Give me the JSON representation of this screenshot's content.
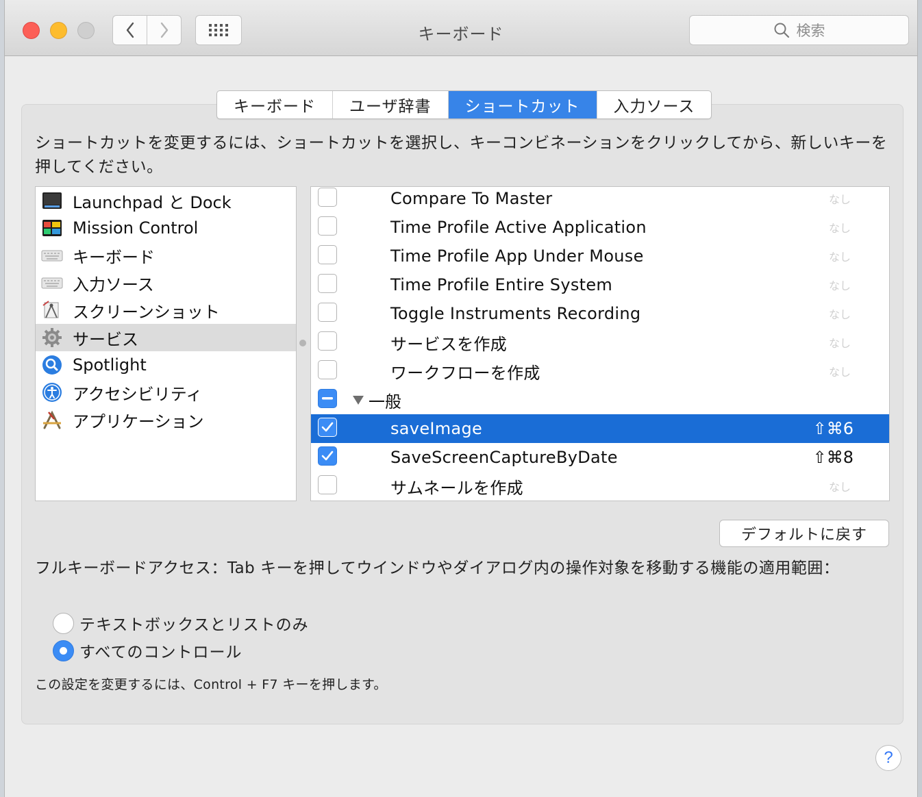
{
  "window": {
    "title": "キーボード",
    "search_placeholder": "検索"
  },
  "tabs": [
    {
      "label": "キーボード",
      "active": false
    },
    {
      "label": "ユーザ辞書",
      "active": false
    },
    {
      "label": "ショートカット",
      "active": true
    },
    {
      "label": "入力ソース",
      "active": false
    }
  ],
  "instruction": "ショートカットを変更するには、ショートカットを選択し、キーコンビネーションをクリックしてから、新しいキーを押してください。",
  "categories": [
    {
      "label": "Launchpad と Dock",
      "icon": "launchpad-icon"
    },
    {
      "label": "Mission Control",
      "icon": "mission-control-icon"
    },
    {
      "label": "キーボード",
      "icon": "keyboard-icon"
    },
    {
      "label": "入力ソース",
      "icon": "keyboard-icon"
    },
    {
      "label": "スクリーンショット",
      "icon": "screenshot-icon"
    },
    {
      "label": "サービス",
      "icon": "gear-icon",
      "selected": true
    },
    {
      "label": "Spotlight",
      "icon": "spotlight-icon"
    },
    {
      "label": "アクセシビリティ",
      "icon": "accessibility-icon"
    },
    {
      "label": "アプリケーション",
      "icon": "app-store-icon"
    }
  ],
  "shortcuts": [
    {
      "label": "Compare To Master",
      "checked": false,
      "key": "なし"
    },
    {
      "label": "Time Profile Active Application",
      "checked": false,
      "key": "なし"
    },
    {
      "label": "Time Profile App Under Mouse",
      "checked": false,
      "key": "なし"
    },
    {
      "label": "Time Profile Entire System",
      "checked": false,
      "key": "なし"
    },
    {
      "label": "Toggle Instruments Recording",
      "checked": false,
      "key": "なし"
    },
    {
      "label": "サービスを作成",
      "checked": false,
      "key": "なし"
    },
    {
      "label": "ワークフローを作成",
      "checked": false,
      "key": "なし"
    },
    {
      "label": "一般",
      "group": true,
      "state": "mixed"
    },
    {
      "label": "saveImage",
      "checked": true,
      "key": "⇧⌘6",
      "selected": true
    },
    {
      "label": "SaveScreenCaptureByDate",
      "checked": true,
      "key": "⇧⌘8"
    },
    {
      "label": "サムネールを作成",
      "checked": false,
      "key": "なし"
    }
  ],
  "default_button": "デフォルトに戻す",
  "full_keyboard_access": {
    "label": "フルキーボードアクセス：Tab キーを押してウインドウやダイアログ内の操作対象を移動する機能の適用範囲：",
    "options": [
      {
        "label": "テキストボックスとリストのみ",
        "selected": false
      },
      {
        "label": "すべてのコントロール",
        "selected": true
      }
    ],
    "note": "この設定を変更するには、Control + F7 キーを押します。"
  },
  "help_label": "?",
  "colors": {
    "accent": "#3784e8",
    "selection": "#1a6dd6"
  }
}
